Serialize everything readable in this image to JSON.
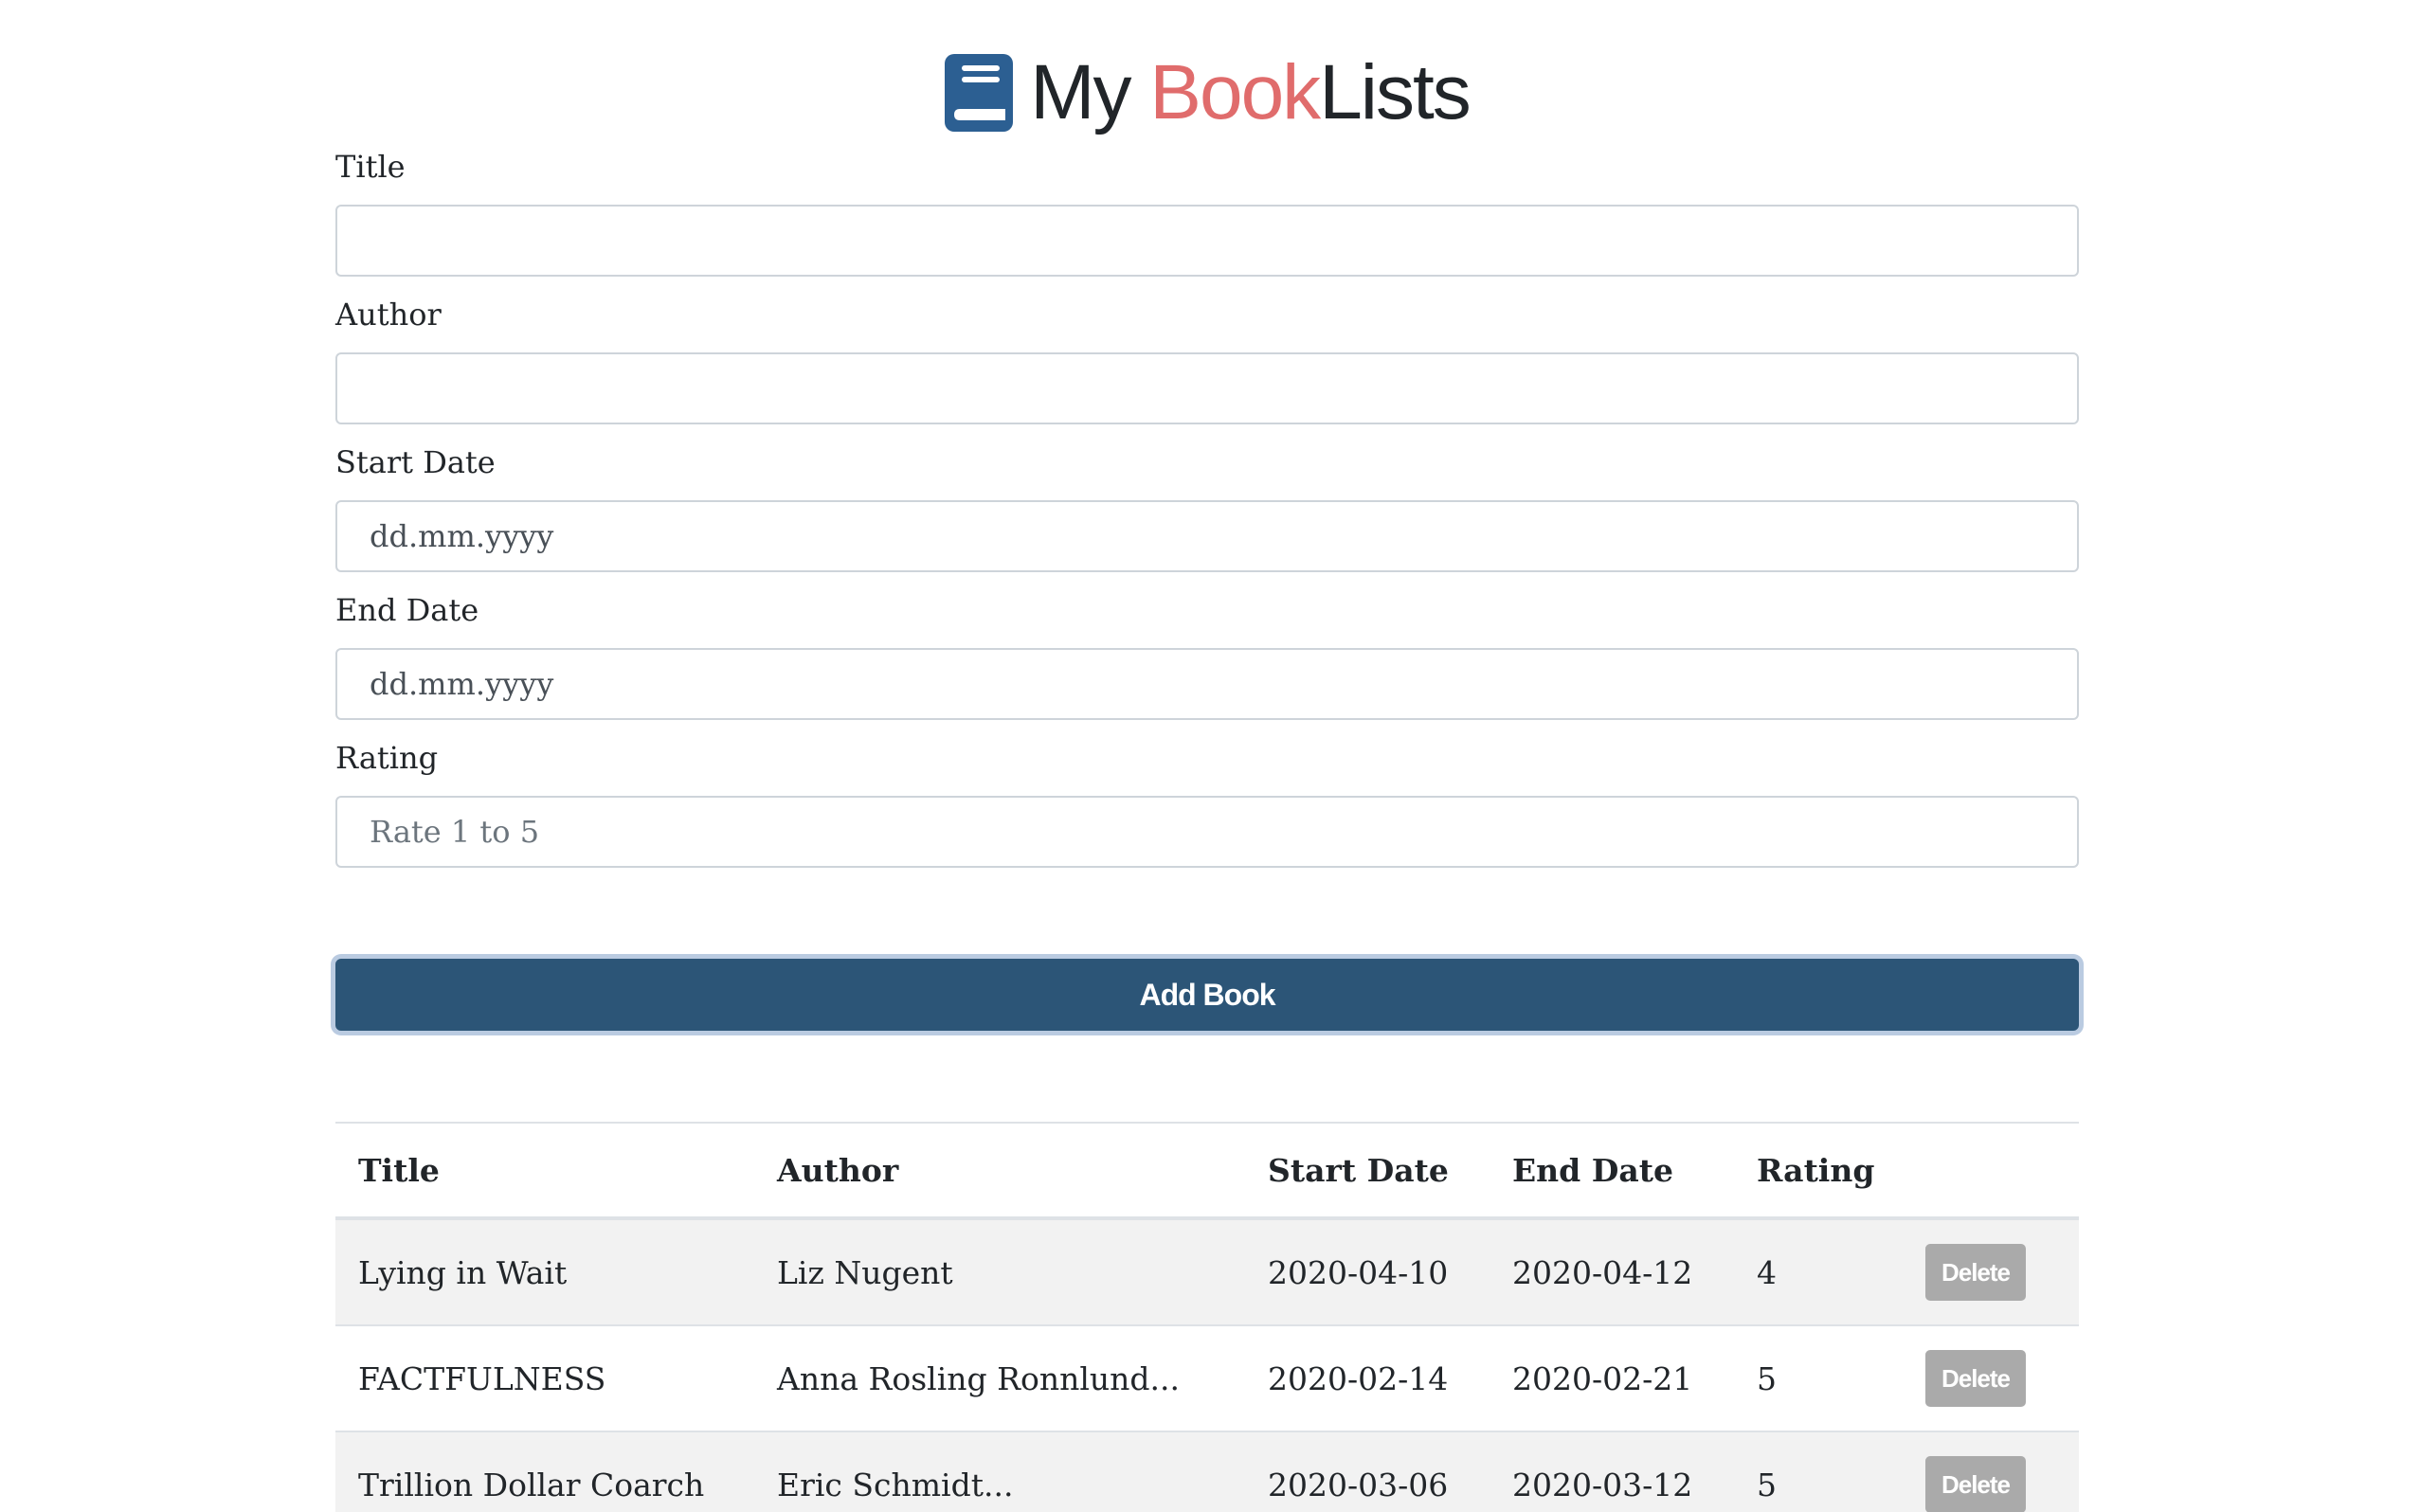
{
  "header": {
    "title_part1": "My ",
    "title_accent": "Book",
    "title_part2": "Lists",
    "accent_color": "#e06c6c",
    "icon": "book-icon"
  },
  "form": {
    "title_label": "Title",
    "title_value": "",
    "author_label": "Author",
    "author_value": "",
    "start_date_label": "Start Date",
    "start_date_placeholder": "dd.mm.yyyy",
    "end_date_label": "End Date",
    "end_date_placeholder": "dd.mm.yyyy",
    "rating_label": "Rating",
    "rating_placeholder": "Rate 1 to 5",
    "submit_label": "Add Book",
    "submit_color": "#2c5577"
  },
  "table": {
    "columns": [
      "Title",
      "Author",
      "Start Date",
      "End Date",
      "Rating",
      ""
    ],
    "rows": [
      {
        "title": "Lying in Wait",
        "author": "Liz Nugent",
        "start": "2020-04-10",
        "end": "2020-04-12",
        "rating": "4",
        "action": "Delete"
      },
      {
        "title": "FACTFULNESS",
        "author": "Anna Rosling Ronnlund...",
        "start": "2020-02-14",
        "end": "2020-02-21",
        "rating": "5",
        "action": "Delete"
      },
      {
        "title": "Trillion Dollar Coarch",
        "author": "Eric Schmidt...",
        "start": "2020-03-06",
        "end": "2020-03-12",
        "rating": "5",
        "action": "Delete"
      }
    ]
  }
}
